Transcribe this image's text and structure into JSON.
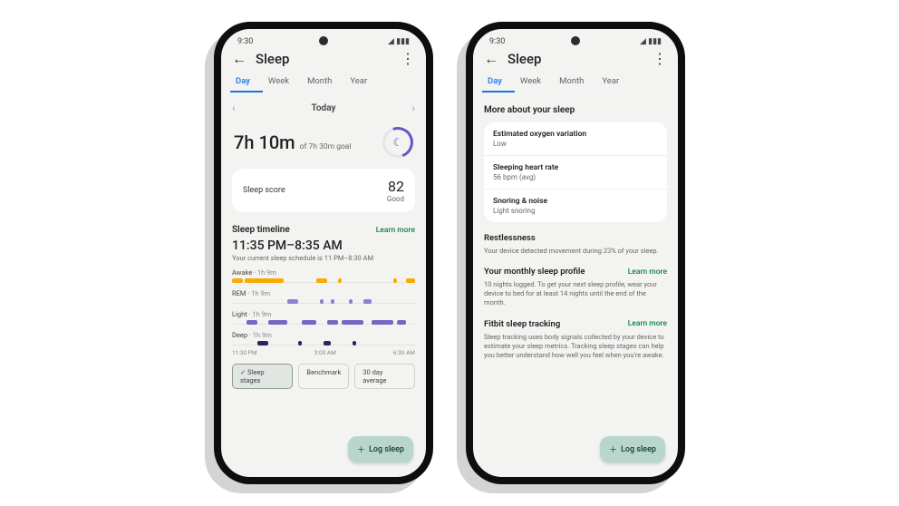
{
  "status": {
    "time": "9:30",
    "indicators": "◢ ▮▮▮"
  },
  "header": {
    "title": "Sleep"
  },
  "tabs": [
    "Day",
    "Week",
    "Month",
    "Year"
  ],
  "tab_active": 0,
  "left": {
    "range_label": "Today",
    "duration_main": "7h 10m",
    "duration_goal": "of 7h 30m goal",
    "score_card": {
      "label": "Sleep score",
      "value": "82",
      "tag": "Good"
    },
    "timeline_title": "Sleep timeline",
    "learn_more": "Learn more",
    "time_range": "11:35 PM–8:35 AM",
    "schedule_note": "Your current sleep schedule is 11 PM–8:30 AM",
    "stages": [
      {
        "name": "Awake",
        "dur": "1h 9m"
      },
      {
        "name": "REM",
        "dur": "1h 9m"
      },
      {
        "name": "Light",
        "dur": "1h 9m"
      },
      {
        "name": "Deep",
        "dur": "1h 9m"
      }
    ],
    "xaxis": [
      "11:30 PM",
      "3:00 AM",
      "6:30 AM"
    ],
    "chips": {
      "sel": "Sleep stages",
      "a": "Benchmark",
      "b": "30 day average"
    },
    "fab": "Log sleep"
  },
  "right": {
    "more_title": "More about your sleep",
    "panels": [
      {
        "k": "Estimated oxygen variation",
        "v": "Low"
      },
      {
        "k": "Sleeping heart rate",
        "v": "56 bpm (avg)"
      },
      {
        "k": "Snoring & noise",
        "v": "Light snoring"
      }
    ],
    "restless": {
      "t": "Restlessness",
      "p": "Your device detected movement during 23% of your sleep."
    },
    "monthly": {
      "t": "Your monthly sleep profile",
      "link": "Learn more",
      "p": "10 nights logged. To get your next sleep profile, wear your device to bed for at least 14 nights until the end of the month."
    },
    "tracking": {
      "t": "Fitbit sleep tracking",
      "link": "Learn more",
      "p": "Sleep tracking uses body signals collected by your device to estimate your sleep metrics. Tracking sleep stages can help you better understand how well you feel when you're awake."
    },
    "fab": "Log sleep"
  },
  "chart_data": {
    "type": "bar",
    "title": "Sleep timeline",
    "x_start": "11:35 PM",
    "x_end": "8:35 AM",
    "x_ticks": [
      "11:30 PM",
      "3:00 AM",
      "6:30 AM"
    ],
    "series": [
      {
        "name": "Awake",
        "segments": [
          [
            0,
            6
          ],
          [
            7,
            28
          ],
          [
            46,
            52
          ],
          [
            58,
            60
          ],
          [
            88,
            90
          ],
          [
            95,
            100
          ]
        ]
      },
      {
        "name": "REM",
        "segments": [
          [
            30,
            36
          ],
          [
            48,
            50
          ],
          [
            54,
            56
          ],
          [
            64,
            66
          ],
          [
            72,
            76
          ]
        ]
      },
      {
        "name": "Light",
        "segments": [
          [
            8,
            14
          ],
          [
            20,
            30
          ],
          [
            38,
            46
          ],
          [
            52,
            58
          ],
          [
            60,
            72
          ],
          [
            76,
            88
          ],
          [
            90,
            95
          ]
        ]
      },
      {
        "name": "Deep",
        "segments": [
          [
            14,
            20
          ],
          [
            36,
            38
          ],
          [
            50,
            54
          ],
          [
            66,
            68
          ]
        ]
      }
    ],
    "durations": {
      "Awake": "1h 9m",
      "REM": "1h 9m",
      "Light": "1h 9m",
      "Deep": "1h 9m"
    }
  }
}
